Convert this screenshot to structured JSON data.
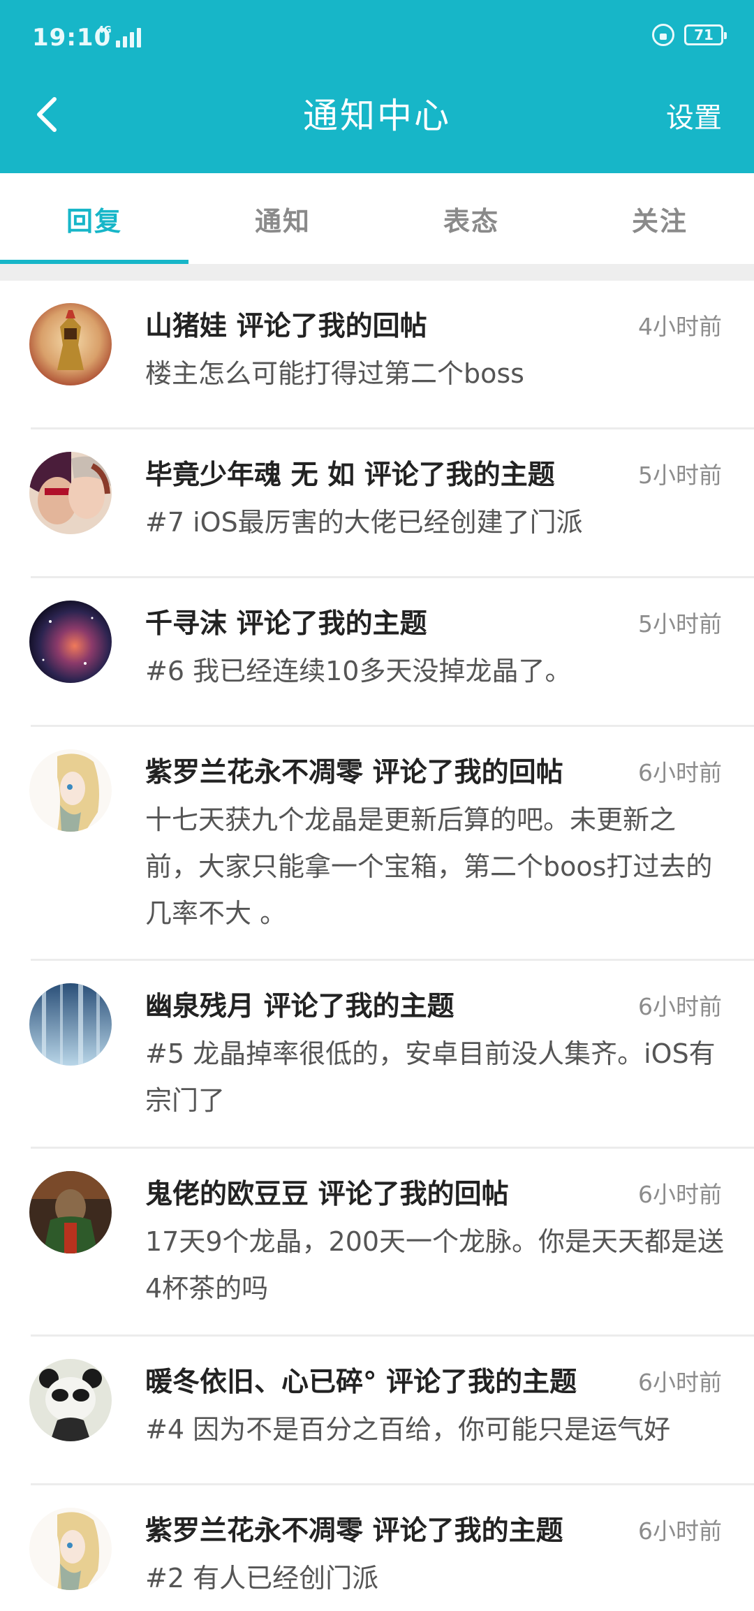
{
  "status_bar": {
    "time": "19:10",
    "network": "4G",
    "battery": "71"
  },
  "header": {
    "title": "通知中心",
    "settings_label": "设置"
  },
  "tabs": [
    {
      "label": "回复",
      "active": true
    },
    {
      "label": "通知",
      "active": false
    },
    {
      "label": "表态",
      "active": false
    },
    {
      "label": "关注",
      "active": false
    }
  ],
  "notifications": [
    {
      "user": "山猪娃",
      "action": "评论了我的回帖",
      "time": "4小时前",
      "content": "楼主怎么可能打得过第二个boss",
      "avatar_icon": "golden-knight-avatar"
    },
    {
      "user": "毕竟少年魂 无 如",
      "action": "评论了我的主题",
      "time": "5小时前",
      "content": "#7 iOS最厉害的大佬已经创建了门派",
      "avatar_icon": "couple-photo-avatar"
    },
    {
      "user": "千寻沫",
      "action": "评论了我的主题",
      "time": "5小时前",
      "content": "#6 我已经连续10多天没掉龙晶了。",
      "avatar_icon": "nebula-avatar"
    },
    {
      "user": "紫罗兰花永不凋零",
      "action": "评论了我的回帖",
      "time": "6小时前",
      "content": "十七天获九个龙晶是更新后算的吧。未更新之前，大家只能拿一个宝箱，第二个boos打过去的几率不大 。",
      "avatar_icon": "anime-girl-avatar"
    },
    {
      "user": "幽泉残月",
      "action": "评论了我的主题",
      "time": "6小时前",
      "content": "#5 龙晶掉率很低的，安卓目前没人集齐。iOS有宗门了",
      "avatar_icon": "blue-forest-avatar"
    },
    {
      "user": "鬼佬的欧豆豆",
      "action": "评论了我的回帖",
      "time": "6小时前",
      "content": "17天9个龙晶，200天一个龙脉。你是天天都是送4杯茶的吗",
      "avatar_icon": "warrior-avatar"
    },
    {
      "user": "暖冬依旧、心已碎°",
      "action": "评论了我的主题",
      "time": "6小时前",
      "content": "#4 因为不是百分之百给，你可能只是运气好",
      "avatar_icon": "panda-avatar"
    },
    {
      "user": "紫罗兰花永不凋零",
      "action": "评论了我的主题",
      "time": "6小时前",
      "content": "#2 有人已经创门派",
      "avatar_icon": "anime-girl-avatar"
    }
  ],
  "colors": {
    "accent": "#17b6c8",
    "title_text": "#222222",
    "body_text": "#555555",
    "time_text": "#8c8c8c"
  }
}
